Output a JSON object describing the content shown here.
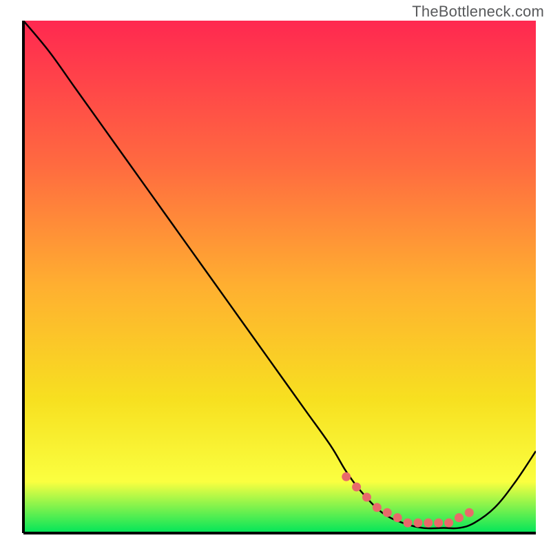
{
  "watermark": "TheBottleneck.com",
  "colors": {
    "gradient_top": "#ff2850",
    "gradient_q1": "#ff6a40",
    "gradient_mid": "#ffb030",
    "gradient_q3": "#f7e020",
    "gradient_near_bottom": "#faff40",
    "gradient_bottom": "#00e55a",
    "axis": "#000000",
    "curve": "#000000",
    "marker": "#e86a6a"
  },
  "chart_data": {
    "type": "line",
    "title": "",
    "xlabel": "",
    "ylabel": "",
    "xlim": [
      0,
      100
    ],
    "ylim": [
      0,
      100
    ],
    "series": [
      {
        "name": "bottleneck-curve",
        "x": [
          0,
          5,
          10,
          15,
          20,
          25,
          30,
          35,
          40,
          45,
          50,
          55,
          60,
          63,
          66,
          70,
          74,
          78,
          82,
          85,
          88,
          92,
          96,
          100
        ],
        "y": [
          100,
          94,
          87,
          80,
          73,
          66,
          59,
          52,
          45,
          38,
          31,
          24,
          17,
          12,
          8,
          4,
          2,
          1,
          1,
          1,
          2,
          5,
          10,
          16
        ]
      }
    ],
    "markers": {
      "name": "optimal-region",
      "x": [
        63,
        65,
        67,
        69,
        71,
        73,
        75,
        77,
        79,
        81,
        83,
        85,
        87
      ],
      "y": [
        11,
        9,
        7,
        5,
        4,
        3,
        2,
        2,
        2,
        2,
        2,
        3,
        4
      ]
    }
  }
}
